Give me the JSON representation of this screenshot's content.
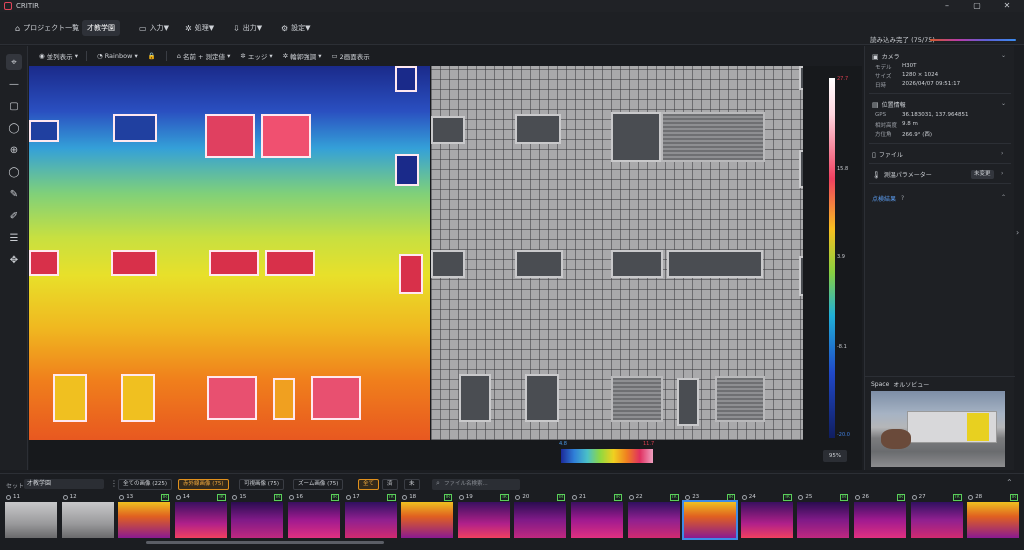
{
  "window": {
    "title": "CRITIR",
    "minimize": "–",
    "maximize": "▢",
    "close": "✕"
  },
  "menu": {
    "items": [
      {
        "icon": "⌂",
        "label": "プロジェクト一覧"
      },
      {
        "icon": "",
        "label": "才教学園"
      },
      {
        "icon": "▭",
        "label": "入力"
      },
      {
        "icon": "✲",
        "label": "処理"
      },
      {
        "icon": "⇩",
        "label": "出力"
      },
      {
        "icon": "⚙",
        "label": "設定"
      }
    ],
    "load_status": "読み込み完了 (75/75)"
  },
  "view_toolbar": {
    "items": [
      {
        "icon": "◉",
        "label": "並列表示",
        "dropdown": true
      },
      {
        "icon": "◔",
        "label": "Rainbow",
        "dropdown": true
      },
      {
        "icon": "🔒",
        "label": "",
        "dropdown": false
      },
      {
        "icon": "⌂",
        "label": "名前 + 測定値",
        "dropdown": true
      },
      {
        "icon": "✲",
        "label": "エッジ",
        "dropdown": true
      },
      {
        "icon": "✲",
        "label": "輪郭強調",
        "dropdown": true
      },
      {
        "icon": "▭",
        "label": "2画面表示",
        "dropdown": false
      }
    ]
  },
  "thermal_scale": {
    "max": "27.7",
    "ticks": [
      "15.8",
      "3.9",
      "-8.1"
    ],
    "min": "-20.0",
    "range_low": "4.8",
    "range_high": "11.7"
  },
  "zoom": "95%",
  "right_panel": {
    "camera": {
      "title": "カメラ",
      "model_label": "モデル",
      "model": "H30T",
      "size_label": "サイズ",
      "size": "1280 × 1024",
      "date_label": "日時",
      "date": "2026/04/07 09:51:17"
    },
    "location": {
      "title": "位置情報",
      "gps_label": "GPS",
      "gps": "36.183031, 137.964851",
      "alt_label": "相対高度",
      "alt": "9.8 m",
      "azimuth_label": "方位角",
      "azimuth": "266.9° (西)"
    },
    "file": {
      "title": "ファイル"
    },
    "params": {
      "title": "測温パラメーター",
      "badge": "未変更"
    },
    "inspection": {
      "title": "点検結果"
    },
    "space": {
      "title": "Space",
      "mode": "オルソビュー"
    }
  },
  "bottom": {
    "set_label": "セット:",
    "set_value": "才教学園",
    "filters": [
      {
        "label": "全ての画像 (225)",
        "active": false
      },
      {
        "label": "赤外線画像 (75)",
        "active": true
      },
      {
        "label": "可視画像 (75)",
        "active": false
      },
      {
        "label": "ズーム画像 (75)",
        "active": false
      }
    ],
    "subfilters": [
      {
        "label": "全て",
        "active": true
      },
      {
        "label": "済",
        "active": false
      },
      {
        "label": "未",
        "active": false
      }
    ],
    "search_placeholder": "ファイル名検索...",
    "thumbs": [
      {
        "num": "11",
        "type": "visible"
      },
      {
        "num": "12",
        "type": "visible"
      },
      {
        "num": "13",
        "type": "ir"
      },
      {
        "num": "14",
        "type": "ir"
      },
      {
        "num": "15",
        "type": "ir"
      },
      {
        "num": "16",
        "type": "ir"
      },
      {
        "num": "17",
        "type": "ir"
      },
      {
        "num": "18",
        "type": "ir"
      },
      {
        "num": "19",
        "type": "ir"
      },
      {
        "num": "20",
        "type": "ir"
      },
      {
        "num": "21",
        "type": "ir"
      },
      {
        "num": "22",
        "type": "ir"
      },
      {
        "num": "23",
        "type": "ir"
      },
      {
        "num": "24",
        "type": "ir"
      },
      {
        "num": "25",
        "type": "ir"
      },
      {
        "num": "26",
        "type": "ir"
      },
      {
        "num": "27",
        "type": "ir"
      },
      {
        "num": "28",
        "type": "ir"
      }
    ],
    "ir_tag": "IR"
  }
}
